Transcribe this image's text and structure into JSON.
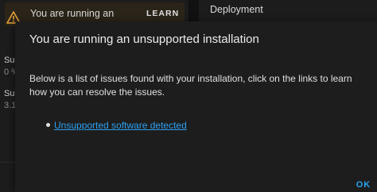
{
  "background": {
    "alert": {
      "icon": "warning-triangle-icon",
      "text": "You are running an",
      "learn_label": "LEARN"
    },
    "deployment_label": "Deployment",
    "side_values": [
      {
        "text": "Su"
      },
      {
        "text": "0 %"
      },
      {
        "text": "Su"
      },
      {
        "text": "3.1"
      }
    ]
  },
  "dialog": {
    "title": "You are running an unsupported installation",
    "body": "Below is a list of issues found with your installation, click on the links to learn how you can resolve the issues.",
    "issues": [
      {
        "label": "Unsupported software detected"
      }
    ],
    "ok_label": "OK"
  },
  "colors": {
    "accent": "#2ea0f0",
    "warning": "#e8a33d"
  }
}
